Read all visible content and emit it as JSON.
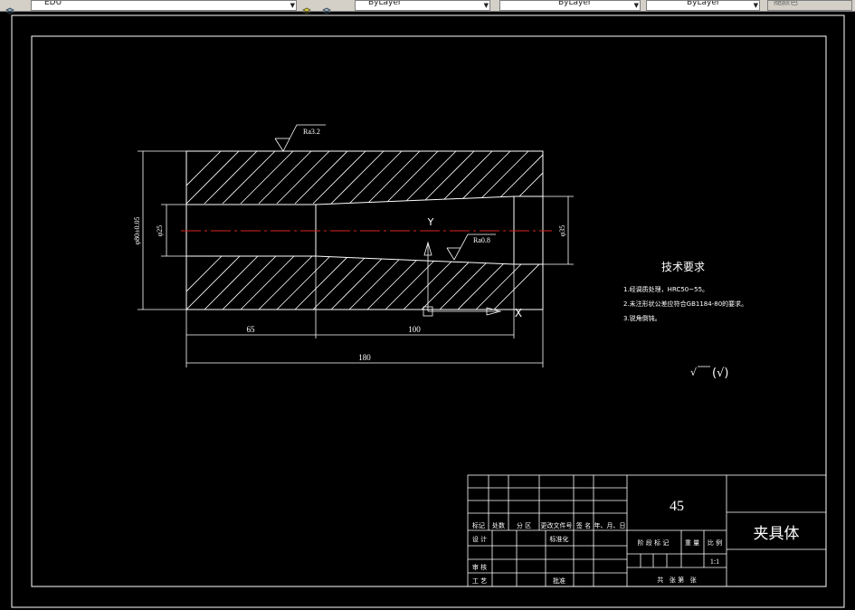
{
  "toolbar": {
    "layer_value": "EDU",
    "color_value": "ByLayer",
    "linetype_value": "ByLayer",
    "lineweight_value": "ByLayer",
    "plotstyle_value": "随颜色"
  },
  "drawing": {
    "roughness_top": "Ra3.2",
    "roughness_bore": "Ra0.8",
    "dim_outer_diameter": "φ80±0.05",
    "dim_bore_left": "φ25",
    "dim_bore_right": "φ35",
    "dim_len_65": "65",
    "dim_len_100": "100",
    "dim_len_180": "180",
    "ucs_y_label": "Y",
    "ucs_x_label": "X",
    "tech_title": "技术要求",
    "tech_items": [
      "1.经调质处理，HRC50~55。",
      "2.未注形状公差应符合GB1184-80的要求。",
      "3.锐角倒钝。"
    ],
    "roughness_other_symbol": "√",
    "roughness_other_paren": "(√)"
  },
  "title_block": {
    "material": "45",
    "part_name": "夹具体",
    "header_cells": [
      "标记",
      "处数",
      "分 区",
      "更改文件号",
      "签 名",
      "年、月、日"
    ],
    "design_label": "设 计",
    "standardize_label": "标准化",
    "review_label": "审 核",
    "process_label": "工 艺",
    "approve_label": "批准",
    "stage_label": "阶 段 标 记",
    "weight_label": "重 量",
    "scale_label": "比 例",
    "scale_value": "1:1",
    "sheet_label": "共   张 第   张"
  }
}
